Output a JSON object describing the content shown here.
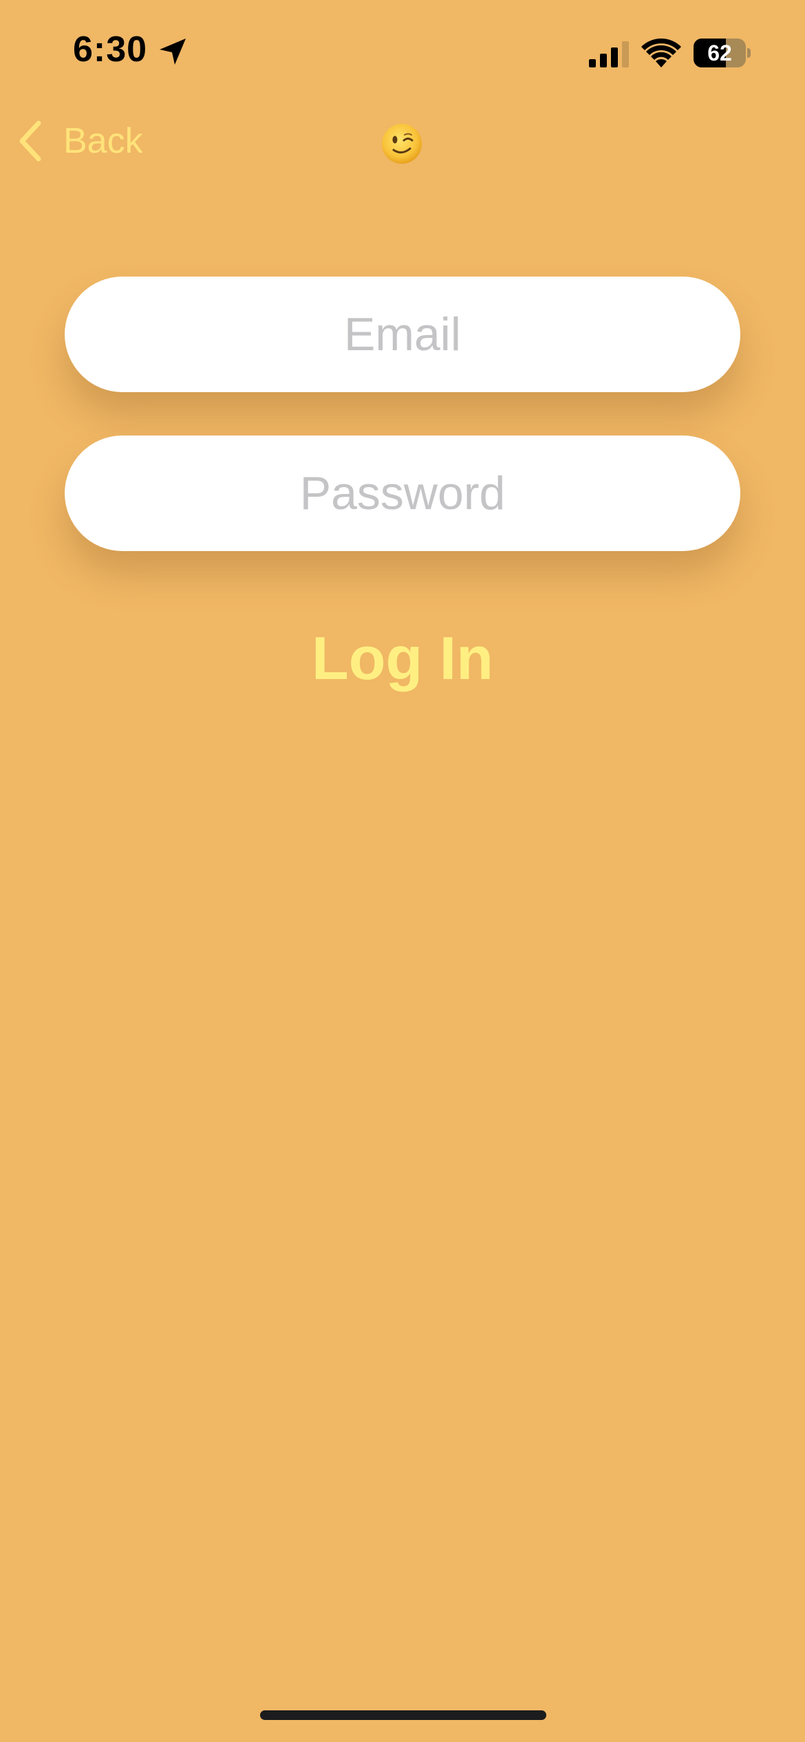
{
  "status_bar": {
    "time": "6:30",
    "battery_percent": "62",
    "battery_level": 0.62,
    "signal_bars_active": 3,
    "icons": [
      "location-arrow-icon",
      "cellular-signal-icon",
      "wifi-icon",
      "battery-icon"
    ]
  },
  "nav": {
    "back_label": "Back",
    "back_icon": "chevron-left-icon",
    "title_emoji": "winking-face-emoji"
  },
  "form": {
    "email_placeholder": "Email",
    "email_value": "",
    "password_placeholder": "Password",
    "password_value": "",
    "login_label": "Log In"
  },
  "colors": {
    "background": "#F0B765",
    "accent": "#FFE37A",
    "login_text": "#FFEF82",
    "placeholder": "#C4C4C6",
    "field_background": "#FFFFFF"
  }
}
